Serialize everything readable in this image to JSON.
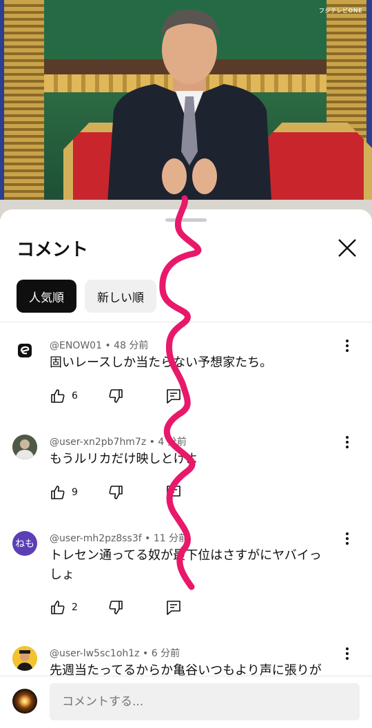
{
  "video": {
    "channel_logo": "フジテレビONE"
  },
  "sheet": {
    "title": "コメント",
    "close_icon": "close-icon",
    "chips": [
      {
        "label": "人気順",
        "selected": true
      },
      {
        "label": "新しい順",
        "selected": false
      }
    ]
  },
  "comments": [
    {
      "user": "@ENOW01",
      "time": "48 分前",
      "text": "固いレースしか当たらない予想家たち。",
      "likes": "6",
      "avatar_color": "#ffffff",
      "avatar_text": ""
    },
    {
      "user": "@user-xn2pb7hm7z",
      "time": "4 分前",
      "text": "もうルリカだけ映しとけよ",
      "likes": "9",
      "avatar_color": "#5a6b4a",
      "avatar_text": ""
    },
    {
      "user": "@user-mh2pz8ss3f",
      "time": "11 分前",
      "text": "トレセン通ってる奴が最下位はさすがにヤバイっしょ",
      "likes": "2",
      "avatar_color": "#5b3fb5",
      "avatar_text": "ねも"
    },
    {
      "user": "@user-lw5sc1oh1z",
      "time": "6 分前",
      "text": "先週当たってるからか亀谷いつもより声に張りが",
      "likes": "",
      "avatar_color": "#e6b320",
      "avatar_text": ""
    }
  ],
  "composer": {
    "placeholder": "コメントする..."
  },
  "colors": {
    "accent_pink": "#e8196a"
  }
}
